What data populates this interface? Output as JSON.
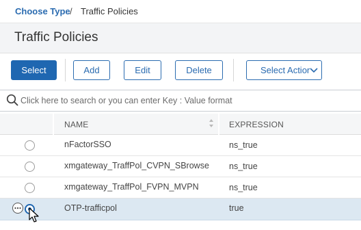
{
  "breadcrumb": {
    "parent": "Choose Type",
    "separator": "/",
    "current": "Traffic Policies"
  },
  "page": {
    "title": "Traffic Policies"
  },
  "toolbar": {
    "select_label": "Select",
    "add_label": "Add",
    "edit_label": "Edit",
    "delete_label": "Delete",
    "select_action_label": "Select Actior"
  },
  "search": {
    "placeholder": "Click here to search or you can enter Key : Value format"
  },
  "table": {
    "columns": [
      "NAME",
      "EXPRESSION"
    ],
    "rows": [
      {
        "name": "nFactorSSO",
        "expression": "ns_true",
        "selected": false
      },
      {
        "name": "xmgateway_TraffPol_CVPN_SBrowse",
        "expression": "ns_true",
        "selected": false
      },
      {
        "name": "xmgateway_TraffPol_FVPN_MVPN",
        "expression": "ns_true",
        "selected": false
      },
      {
        "name": "OTP-trafficpol",
        "expression": "true",
        "selected": true
      }
    ]
  },
  "colors": {
    "accent": "#1f67b1",
    "selected_row": "#dce8f2"
  },
  "icons": [
    "search-icon",
    "sort-icon",
    "more-options-icon",
    "mouse-cursor-icon",
    "chevron-down-icon"
  ]
}
